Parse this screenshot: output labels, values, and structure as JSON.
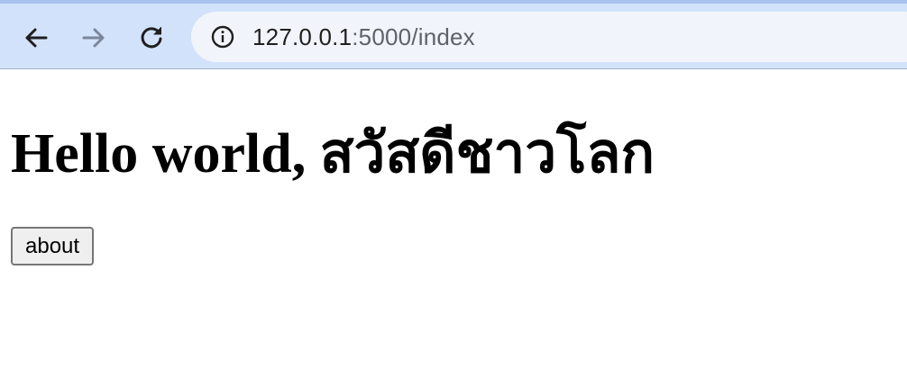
{
  "browser": {
    "url_host": "127.0.0.1",
    "url_path": ":5000/index",
    "icons": {
      "back": "back-arrow-icon",
      "forward": "forward-arrow-icon",
      "reload": "reload-icon",
      "site_info": "info-icon"
    }
  },
  "page": {
    "heading": "Hello world, สวัสดีชาวโลก",
    "about_button_label": "about"
  }
}
